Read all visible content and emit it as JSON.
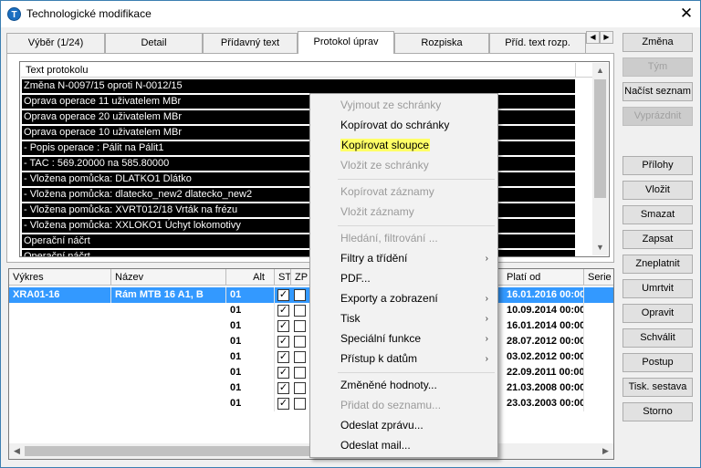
{
  "window": {
    "title": "Technologické modifikace",
    "close_label": "✕"
  },
  "tabs": [
    {
      "label": "Výběr (1/24)"
    },
    {
      "label": "Detail"
    },
    {
      "label": "Přídavný text"
    },
    {
      "label": "Protokol úprav",
      "active": true
    },
    {
      "label": "Rozpiska"
    },
    {
      "label": "Příd. text rozp."
    }
  ],
  "tab_arrows": {
    "left": "◀",
    "right": "▶"
  },
  "protocol": {
    "header": "Text protokolu",
    "rows": [
      "Změna N-0097/15 oproti N-0012/15",
      "Oprava operace 11  uživatelem MBr",
      "Oprava operace 20  uživatelem MBr",
      "Oprava operace 10  uživatelem MBr",
      "- Popis operace : Pálit na Pálit1",
      "- TAC : 569.20000 na 585.80000",
      "- Vložena pomůcka: DLATKO1 Dlátko",
      "- Vložena pomůcka: dlatecko_new2 dlatecko_new2",
      "- Vložena pomůcka: XVRT012/18 Vrták na frézu",
      "- Vložena pomůcka: XXLOKO1 Úchyt lokomotivy",
      "Operační náčrt",
      "Operační náčrt"
    ],
    "scroll_up": "▲",
    "scroll_down": "▼"
  },
  "grid": {
    "columns": [
      "Výkres",
      "Název",
      "Alt",
      "ST",
      "ZP",
      "Platí od",
      "Serie"
    ],
    "rows": [
      {
        "vykres": "XRA01-16",
        "nazev": "Rám MTB 16 A1, B",
        "alt": "01",
        "st": "✓",
        "zp": "",
        "plati_od": "16.01.2016 00:00",
        "selected": true
      },
      {
        "vykres": "",
        "nazev": "",
        "alt": "01",
        "st": "✓",
        "zp": "",
        "plati_od": "10.09.2014 00:00"
      },
      {
        "vykres": "",
        "nazev": "",
        "alt": "01",
        "st": "✓",
        "zp": "",
        "plati_od": "16.01.2014 00:00"
      },
      {
        "vykres": "",
        "nazev": "",
        "alt": "01",
        "st": "✓",
        "zp": "",
        "plati_od": "28.07.2012 00:00"
      },
      {
        "vykres": "",
        "nazev": "",
        "alt": "01",
        "st": "✓",
        "zp": "",
        "plati_od": "03.02.2012 00:00"
      },
      {
        "vykres": "",
        "nazev": "",
        "alt": "01",
        "st": "✓",
        "zp": "",
        "plati_od": "22.09.2011 00:00"
      },
      {
        "vykres": "",
        "nazev": "",
        "alt": "01",
        "st": "✓",
        "zp": "",
        "plati_od": "21.03.2008 00:00"
      },
      {
        "vykres": "",
        "nazev": "",
        "alt": "01",
        "st": "✓",
        "zp": "",
        "plati_od": "23.03.2003 00:00"
      }
    ],
    "scroll_left": "◀",
    "scroll_right": "▶"
  },
  "buttons": [
    {
      "label": "Změna",
      "disabled": false
    },
    {
      "label": "Tým",
      "disabled": true
    },
    {
      "label": "Načíst seznam",
      "disabled": false
    },
    {
      "label": "Vyprázdnit",
      "disabled": true
    },
    {
      "label": "Přílohy",
      "disabled": false
    },
    {
      "label": "Vložit",
      "disabled": false
    },
    {
      "label": "Smazat",
      "disabled": false
    },
    {
      "label": "Zapsat",
      "disabled": false
    },
    {
      "label": "Zneplatnit",
      "disabled": false
    },
    {
      "label": "Umrtvit",
      "disabled": false
    },
    {
      "label": "Opravit",
      "disabled": false
    },
    {
      "label": "Schválit",
      "disabled": false
    },
    {
      "label": "Postup",
      "disabled": false
    },
    {
      "label": "Tisk. sestava",
      "disabled": false
    },
    {
      "label": "Storno",
      "disabled": false
    }
  ],
  "context_menu": {
    "items": [
      {
        "label": "Vyjmout ze schránky",
        "disabled": true
      },
      {
        "label": "Kopírovat do schránky",
        "disabled": false
      },
      {
        "label": "Kopírovat sloupce",
        "disabled": false,
        "highlighted": true
      },
      {
        "label": "Vložit ze schránky",
        "disabled": true
      },
      {
        "label": "Kopírovat záznamy",
        "disabled": true
      },
      {
        "label": "Vložit záznamy",
        "disabled": true
      },
      {
        "label": "Hledání, filtrování ...",
        "disabled": true
      },
      {
        "label": "Filtry a třídění",
        "disabled": false,
        "submenu": true
      },
      {
        "label": "PDF...",
        "disabled": false
      },
      {
        "label": "Exporty a zobrazení",
        "disabled": false,
        "submenu": true
      },
      {
        "label": "Tisk",
        "disabled": false,
        "submenu": true
      },
      {
        "label": "Speciální funkce",
        "disabled": false,
        "submenu": true
      },
      {
        "label": "Přístup k datům",
        "disabled": false,
        "submenu": true
      },
      {
        "label": "Změněné hodnoty...",
        "disabled": false
      },
      {
        "label": "Přidat do seznamu...",
        "disabled": true
      },
      {
        "label": "Odeslat zprávu...",
        "disabled": false
      },
      {
        "label": "Odeslat mail...",
        "disabled": false
      }
    ],
    "submenu_glyph": "›",
    "highlight_color": "#ffff66"
  },
  "colors": {
    "selection": "#3399ff",
    "protocol_row_bg": "#000000",
    "app_icon": "#1b6fc1"
  }
}
